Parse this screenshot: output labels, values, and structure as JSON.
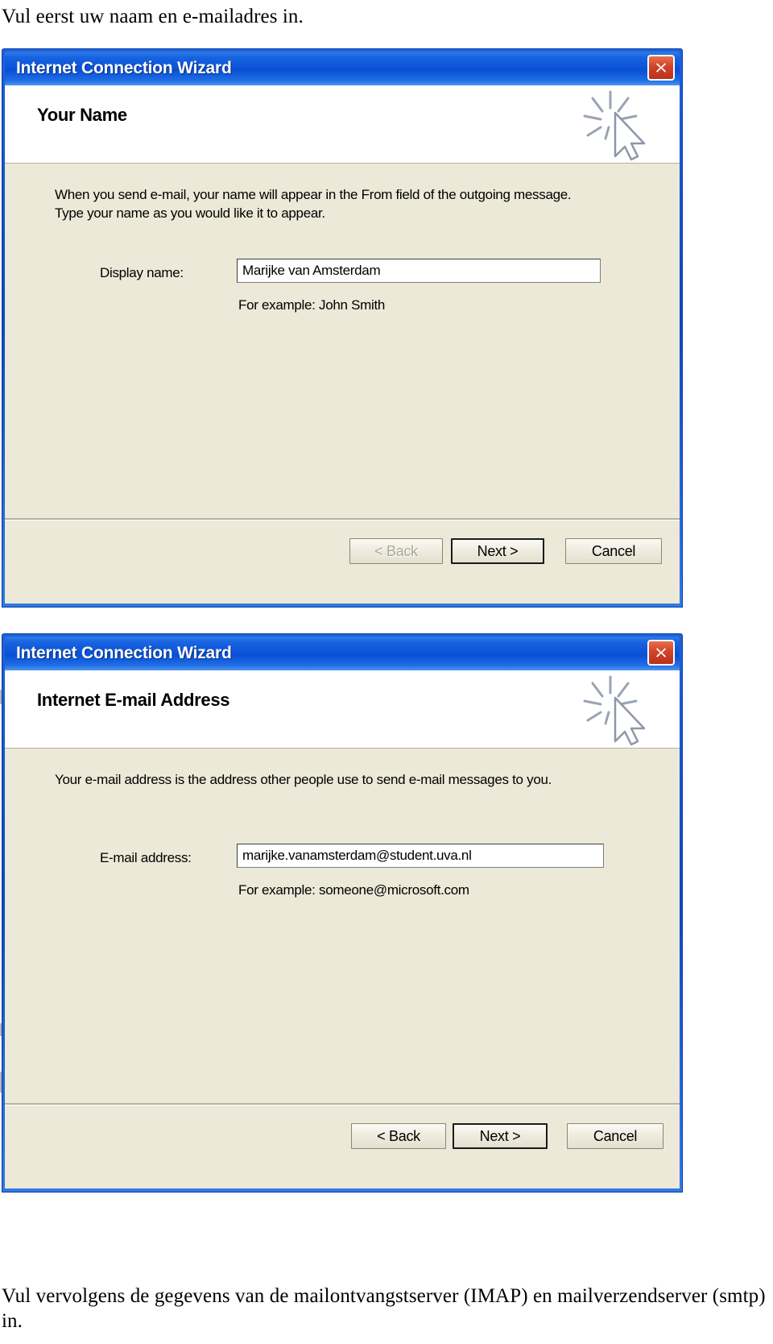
{
  "document": {
    "caption_top": "Vul eerst uw naam en e-mailadres in.",
    "caption_bottom": "Vul vervolgens de gegevens van de mailontvangstserver (IMAP) en mailverzendserver (smtp) in."
  },
  "colors": {
    "titlebar_blue": "#0a4fd6",
    "dialog_face": "#ece9d8",
    "close_red": "#d2432a",
    "banner_white": "#ffffff",
    "border_blue": "#0a2b8c"
  },
  "dialog_name": {
    "window_title": "Internet Connection Wizard",
    "close_icon": "close-icon",
    "banner_graphic_icon": "cursor-sparkle-icon",
    "heading": "Your Name",
    "body_text": "When you send e-mail, your name will appear in the From field of the outgoing message.\nType your name as you would like it to appear.",
    "field_label": "Display name:",
    "field_value": "Marijke van Amsterdam",
    "field_placeholder": "",
    "example_text": "For example: John Smith",
    "buttons": {
      "back": "< Back",
      "next": "Next >",
      "cancel": "Cancel"
    }
  },
  "dialog_email": {
    "window_title": "Internet Connection Wizard",
    "close_icon": "close-icon",
    "banner_graphic_icon": "cursor-sparkle-icon",
    "heading": "Internet E-mail Address",
    "body_text": "Your e-mail address is the address other people use to send e-mail messages to you.",
    "field_label": "E-mail address:",
    "field_value": "marijke.vanamsterdam@student.uva.nl",
    "field_placeholder": "",
    "example_text": "For example: someone@microsoft.com",
    "buttons": {
      "back": "< Back",
      "next": "Next >",
      "cancel": "Cancel"
    }
  }
}
